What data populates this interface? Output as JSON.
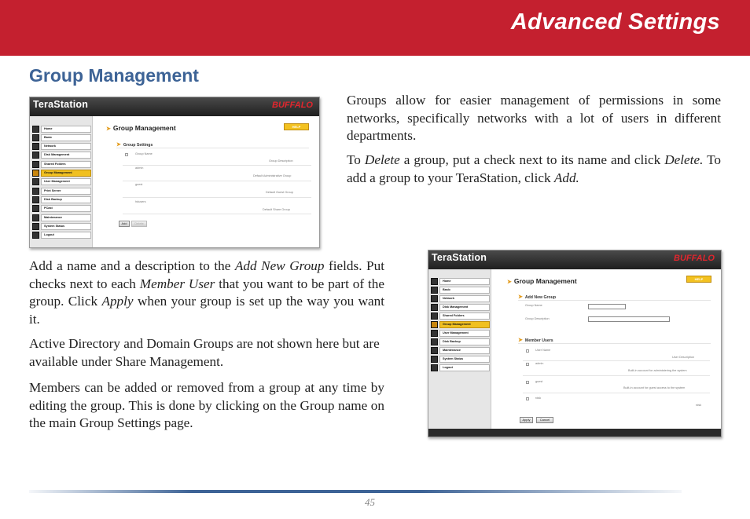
{
  "header": {
    "title": "Advanced Settings"
  },
  "section": {
    "title": "Group Management"
  },
  "text": {
    "p1": "Groups allow for easier management of permissions in some networks, specifically networks with a lot of users in different departments.",
    "p2_a": "To ",
    "p2_delete1": "Delete",
    "p2_b": " a group, put a check next to its name and click ",
    "p2_delete2": "Delete.",
    "p2_c": "  To add a group to your TeraStation, click ",
    "p2_add": "Add.",
    "p3_a": "Add a name and a description to the ",
    "p3_addnew": "Add New Group",
    "p3_b": " fields.  Put checks next to each ",
    "p3_member": "Member User",
    "p3_c": " that you want to be part of the group.  Click ",
    "p3_apply": "Apply",
    "p3_d": " when your group is set up the way you want it.",
    "p4": "Active Directory and Domain Groups are not shown here but are available under Share Management.",
    "p5": "Members can be added or removed from a group at any time by editing the group.  This is done by clicking on the Group name on the main Group Settings page."
  },
  "screenshot1": {
    "logo": "TeraStation",
    "brand": "BUFFALO",
    "title": "Group Management",
    "help": "HELP",
    "subtitle": "Group Settings",
    "col_name": "Group Name",
    "col_desc": "Group Description",
    "rows": [
      {
        "name": "admin",
        "desc": "Default Administrative Group"
      },
      {
        "name": "guest",
        "desc": "Default Guest Group"
      },
      {
        "name": "hdusers",
        "desc": "Default Share Group"
      }
    ],
    "add": "Add",
    "delete": "Delete"
  },
  "screenshot2": {
    "logo": "TeraStation",
    "brand": "BUFFALO",
    "title": "Group Management",
    "help": "HELP",
    "subtitle_add": "Add New Group",
    "field_name": "Group Name",
    "field_desc": "Group Description",
    "subtitle_members": "Member Users",
    "col_user": "User Name",
    "col_desc": "User Description",
    "users": [
      {
        "name": "admin",
        "desc": "Built-in account for administering the system"
      },
      {
        "name": "guest",
        "desc": "Built-in account for guest access to the system"
      },
      {
        "name": "rdsk",
        "desc": "rdsk"
      }
    ],
    "apply": "Apply",
    "cancel": "Cancel"
  },
  "nav": {
    "items": [
      "Home",
      "Basic",
      "Network",
      "Disk Management",
      "Shared Folders",
      "Group Management",
      "User Management",
      "Print Server",
      "Disk Backup",
      "PCast",
      "Maintenance",
      "System Status",
      "Logout"
    ]
  },
  "page": {
    "number": "45"
  }
}
